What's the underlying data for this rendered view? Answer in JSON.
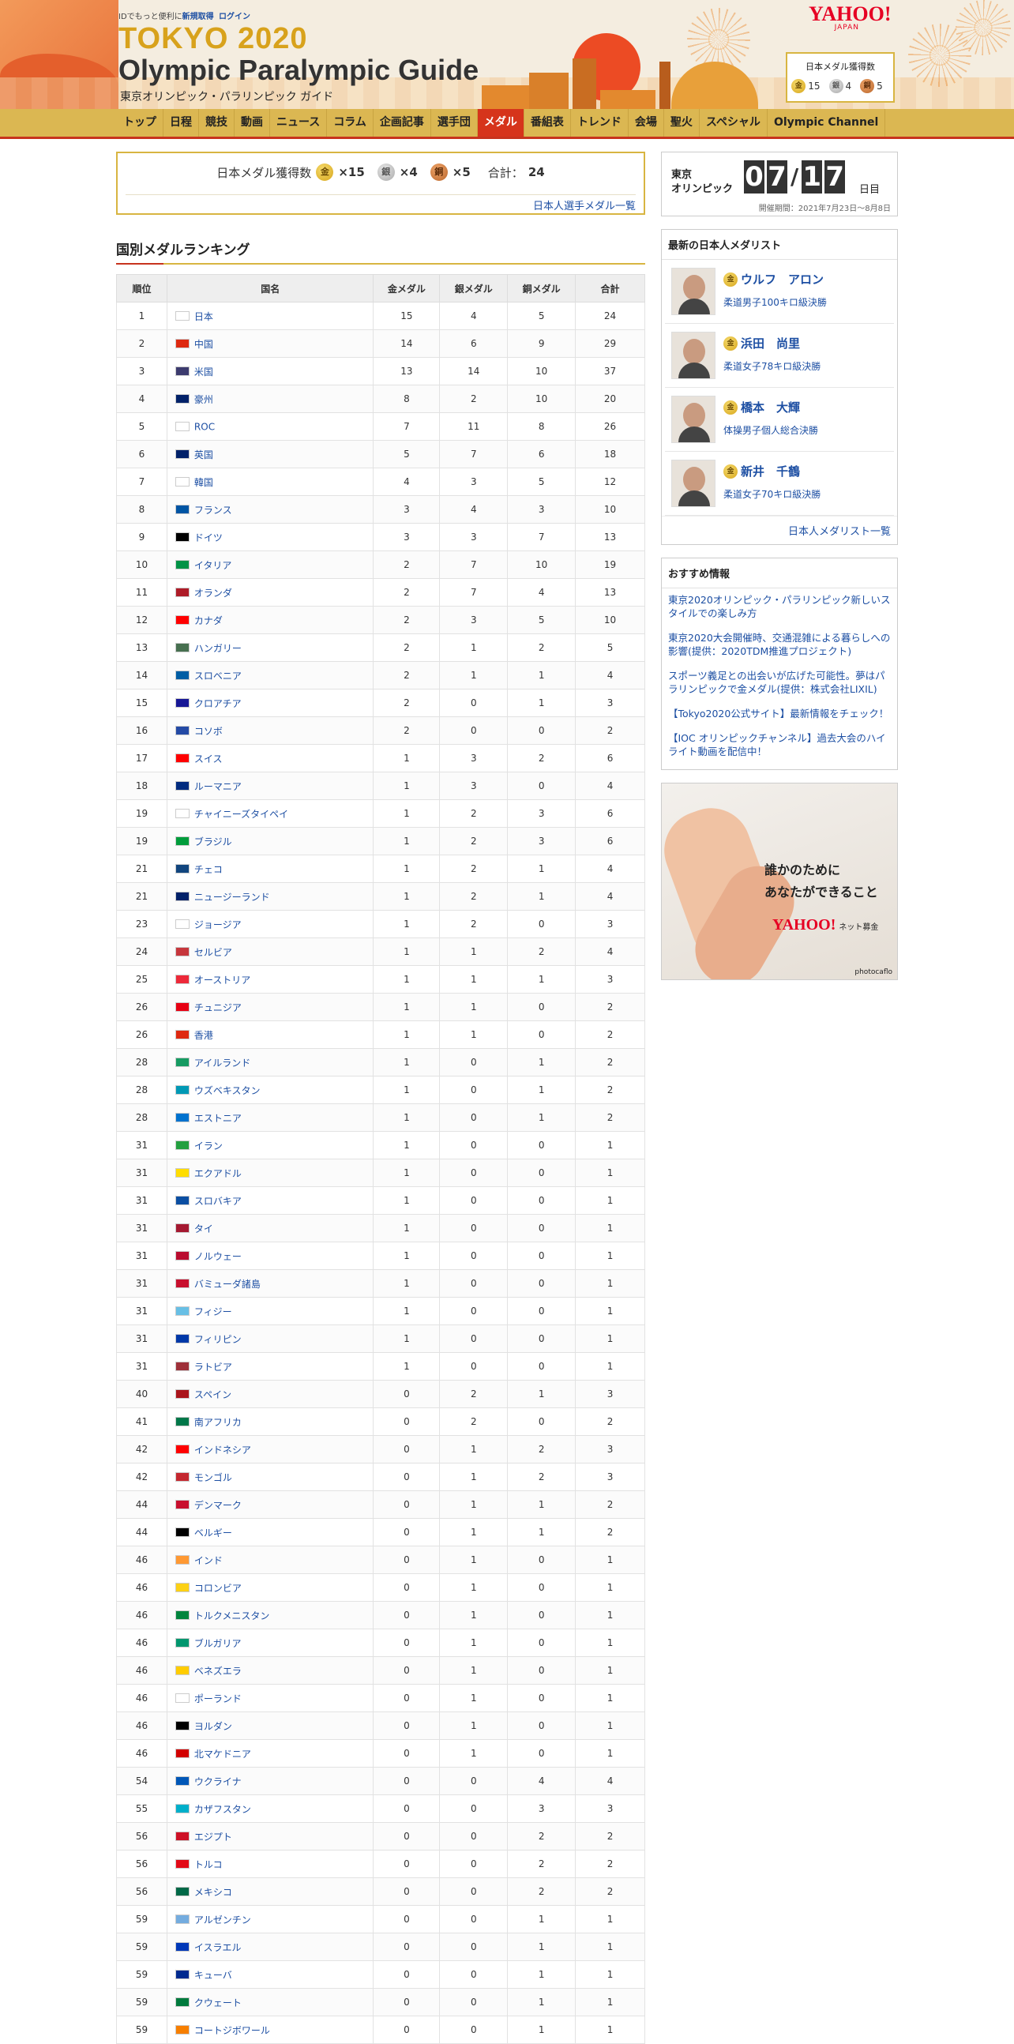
{
  "header": {
    "top_text": "IDでもっと便利に",
    "signup": "新規取得",
    "login": "ログイン",
    "logo_tokyo": "TOKYO 2020",
    "logo_guide": "Olympic Paralympic Guide",
    "logo_sub": "東京オリンピック・パラリンピック ガイド",
    "yahoo": "YAHOO!",
    "yahoo_sub": "JAPAN",
    "medal_box": {
      "title": "日本メダル獲得数",
      "gold": "15",
      "silver": "4",
      "bronze": "5"
    }
  },
  "nav": [
    "トップ",
    "日程",
    "競技",
    "動画",
    "ニュース",
    "コラム",
    "企画記事",
    "選手団",
    "メダル",
    "番組表",
    "トレンド",
    "会場",
    "聖火",
    "スペシャル",
    "Olympic Channel"
  ],
  "nav_active": "メダル",
  "summary": {
    "label": "日本メダル獲得数",
    "gold": "×15",
    "silver": "×4",
    "bronze": "×5",
    "total_label": "合計：",
    "total": "24",
    "link": "日本人選手メダル一覧"
  },
  "medal_glyphs": {
    "gold": "金",
    "silver": "銀",
    "bronze": "銅"
  },
  "ranking": {
    "title": "国別メダルランキング",
    "headers": [
      "順位",
      "国名",
      "金メダル",
      "銀メダル",
      "銅メダル",
      "合計"
    ],
    "rows": [
      [
        "1",
        "日本",
        "15",
        "4",
        "5",
        "24"
      ],
      [
        "2",
        "中国",
        "14",
        "6",
        "9",
        "29"
      ],
      [
        "3",
        "米国",
        "13",
        "14",
        "10",
        "37"
      ],
      [
        "4",
        "豪州",
        "8",
        "2",
        "10",
        "20"
      ],
      [
        "5",
        "ROC",
        "7",
        "11",
        "8",
        "26"
      ],
      [
        "6",
        "英国",
        "5",
        "7",
        "6",
        "18"
      ],
      [
        "7",
        "韓国",
        "4",
        "3",
        "5",
        "12"
      ],
      [
        "8",
        "フランス",
        "3",
        "4",
        "3",
        "10"
      ],
      [
        "9",
        "ドイツ",
        "3",
        "3",
        "7",
        "13"
      ],
      [
        "10",
        "イタリア",
        "2",
        "7",
        "10",
        "19"
      ],
      [
        "11",
        "オランダ",
        "2",
        "7",
        "4",
        "13"
      ],
      [
        "12",
        "カナダ",
        "2",
        "3",
        "5",
        "10"
      ],
      [
        "13",
        "ハンガリー",
        "2",
        "1",
        "2",
        "5"
      ],
      [
        "14",
        "スロベニア",
        "2",
        "1",
        "1",
        "4"
      ],
      [
        "15",
        "クロアチア",
        "2",
        "0",
        "1",
        "3"
      ],
      [
        "16",
        "コソボ",
        "2",
        "0",
        "0",
        "2"
      ],
      [
        "17",
        "スイス",
        "1",
        "3",
        "2",
        "6"
      ],
      [
        "18",
        "ルーマニア",
        "1",
        "3",
        "0",
        "4"
      ],
      [
        "19",
        "チャイニーズタイペイ",
        "1",
        "2",
        "3",
        "6"
      ],
      [
        "19",
        "ブラジル",
        "1",
        "2",
        "3",
        "6"
      ],
      [
        "21",
        "チェコ",
        "1",
        "2",
        "1",
        "4"
      ],
      [
        "21",
        "ニュージーランド",
        "1",
        "2",
        "1",
        "4"
      ],
      [
        "23",
        "ジョージア",
        "1",
        "2",
        "0",
        "3"
      ],
      [
        "24",
        "セルビア",
        "1",
        "1",
        "2",
        "4"
      ],
      [
        "25",
        "オーストリア",
        "1",
        "1",
        "1",
        "3"
      ],
      [
        "26",
        "チュニジア",
        "1",
        "1",
        "0",
        "2"
      ],
      [
        "26",
        "香港",
        "1",
        "1",
        "0",
        "2"
      ],
      [
        "28",
        "アイルランド",
        "1",
        "0",
        "1",
        "2"
      ],
      [
        "28",
        "ウズベキスタン",
        "1",
        "0",
        "1",
        "2"
      ],
      [
        "28",
        "エストニア",
        "1",
        "0",
        "1",
        "2"
      ],
      [
        "31",
        "イラン",
        "1",
        "0",
        "0",
        "1"
      ],
      [
        "31",
        "エクアドル",
        "1",
        "0",
        "0",
        "1"
      ],
      [
        "31",
        "スロバキア",
        "1",
        "0",
        "0",
        "1"
      ],
      [
        "31",
        "タイ",
        "1",
        "0",
        "0",
        "1"
      ],
      [
        "31",
        "ノルウェー",
        "1",
        "0",
        "0",
        "1"
      ],
      [
        "31",
        "バミューダ諸島",
        "1",
        "0",
        "0",
        "1"
      ],
      [
        "31",
        "フィジー",
        "1",
        "0",
        "0",
        "1"
      ],
      [
        "31",
        "フィリピン",
        "1",
        "0",
        "0",
        "1"
      ],
      [
        "31",
        "ラトビア",
        "1",
        "0",
        "0",
        "1"
      ],
      [
        "40",
        "スペイン",
        "0",
        "2",
        "1",
        "3"
      ],
      [
        "41",
        "南アフリカ",
        "0",
        "2",
        "0",
        "2"
      ],
      [
        "42",
        "インドネシア",
        "0",
        "1",
        "2",
        "3"
      ],
      [
        "42",
        "モンゴル",
        "0",
        "1",
        "2",
        "3"
      ],
      [
        "44",
        "デンマーク",
        "0",
        "1",
        "1",
        "2"
      ],
      [
        "44",
        "ベルギー",
        "0",
        "1",
        "1",
        "2"
      ],
      [
        "46",
        "インド",
        "0",
        "1",
        "0",
        "1"
      ],
      [
        "46",
        "コロンビア",
        "0",
        "1",
        "0",
        "1"
      ],
      [
        "46",
        "トルクメニスタン",
        "0",
        "1",
        "0",
        "1"
      ],
      [
        "46",
        "ブルガリア",
        "0",
        "1",
        "0",
        "1"
      ],
      [
        "46",
        "ベネズエラ",
        "0",
        "1",
        "0",
        "1"
      ],
      [
        "46",
        "ポーランド",
        "0",
        "1",
        "0",
        "1"
      ],
      [
        "46",
        "ヨルダン",
        "0",
        "1",
        "0",
        "1"
      ],
      [
        "46",
        "北マケドニア",
        "0",
        "1",
        "0",
        "1"
      ],
      [
        "54",
        "ウクライナ",
        "0",
        "0",
        "4",
        "4"
      ],
      [
        "55",
        "カザフスタン",
        "0",
        "0",
        "3",
        "3"
      ],
      [
        "56",
        "エジプト",
        "0",
        "0",
        "2",
        "2"
      ],
      [
        "56",
        "トルコ",
        "0",
        "0",
        "2",
        "2"
      ],
      [
        "56",
        "メキシコ",
        "0",
        "0",
        "2",
        "2"
      ],
      [
        "59",
        "アルゼンチン",
        "0",
        "0",
        "1",
        "1"
      ],
      [
        "59",
        "イスラエル",
        "0",
        "0",
        "1",
        "1"
      ],
      [
        "59",
        "キューバ",
        "0",
        "0",
        "1",
        "1"
      ],
      [
        "59",
        "クウェート",
        "0",
        "0",
        "1",
        "1"
      ],
      [
        "59",
        "コートジボワール",
        "0",
        "0",
        "1",
        "1"
      ]
    ],
    "flag_colors": [
      "#ffffff",
      "#de2910",
      "#3c3b6e",
      "#012169",
      "#ffffff",
      "#012169",
      "#ffffff",
      "#0055a4",
      "#000000",
      "#009246",
      "#ae1c28",
      "#ff0000",
      "#477050",
      "#005da4",
      "#171796",
      "#244aa5",
      "#ff0000",
      "#002b7f",
      "#ffffff",
      "#009c3b",
      "#11457e",
      "#012169",
      "#ffffff",
      "#c6363c",
      "#ed2939",
      "#e70013",
      "#de2910",
      "#169b62",
      "#0099b5",
      "#0072ce",
      "#239f40",
      "#ffdd00",
      "#0b4ea2",
      "#a51931",
      "#ba0c2f",
      "#c8102e",
      "#68bfe5",
      "#0038a8",
      "#9e3039",
      "#aa151b",
      "#007749",
      "#ff0000",
      "#c4272f",
      "#c8102e",
      "#000000",
      "#ff9933",
      "#fcd116",
      "#00843d",
      "#00966e",
      "#ffcc00",
      "#ffffff",
      "#000000",
      "#d20000",
      "#0057b7",
      "#00afca",
      "#ce1126",
      "#e30a17",
      "#006847",
      "#74acdf",
      "#0038b8",
      "#002a8f",
      "#007a3d",
      "#f77f00"
    ]
  },
  "countdown": {
    "label_line1": "東京",
    "label_line2": "オリンピック",
    "month": [
      "0",
      "7"
    ],
    "day": [
      "1",
      "7"
    ],
    "slash": "/",
    "suffix": "日目",
    "period": "開催期間：2021年7月23日〜8月8日"
  },
  "medalists": {
    "title": "最新の日本人メダリスト",
    "items": [
      {
        "name": "ウルフ　アロン",
        "event": "柔道男子100キロ級決勝"
      },
      {
        "name": "浜田　尚里",
        "event": "柔道女子78キロ級決勝"
      },
      {
        "name": "橋本　大輝",
        "event": "体操男子個人総合決勝"
      },
      {
        "name": "新井　千鶴",
        "event": "柔道女子70キロ級決勝"
      }
    ],
    "more": "日本人メダリスト一覧"
  },
  "recommended": {
    "title": "おすすめ情報",
    "items": [
      "東京2020オリンピック・パラリンピック新しいスタイルでの楽しみ方",
      "東京2020大会開催時、交通混雑による暮らしへの影響(提供：2020TDM推進プロジェクト)",
      "スポーツ義足との出会いが広げた可能性。夢はパラリンピックで金メダル(提供：株式会社LIXIL)",
      "【Tokyo2020公式サイト】最新情報をチェック！",
      "【IOC オリンピックチャンネル】過去大会のハイライト動画を配信中！"
    ]
  },
  "ad": {
    "line1": "誰かのために",
    "line2": "あなたができること",
    "logo": "YAHOO!",
    "logo_sub": "ネット募金",
    "credit": "photocaflo"
  }
}
